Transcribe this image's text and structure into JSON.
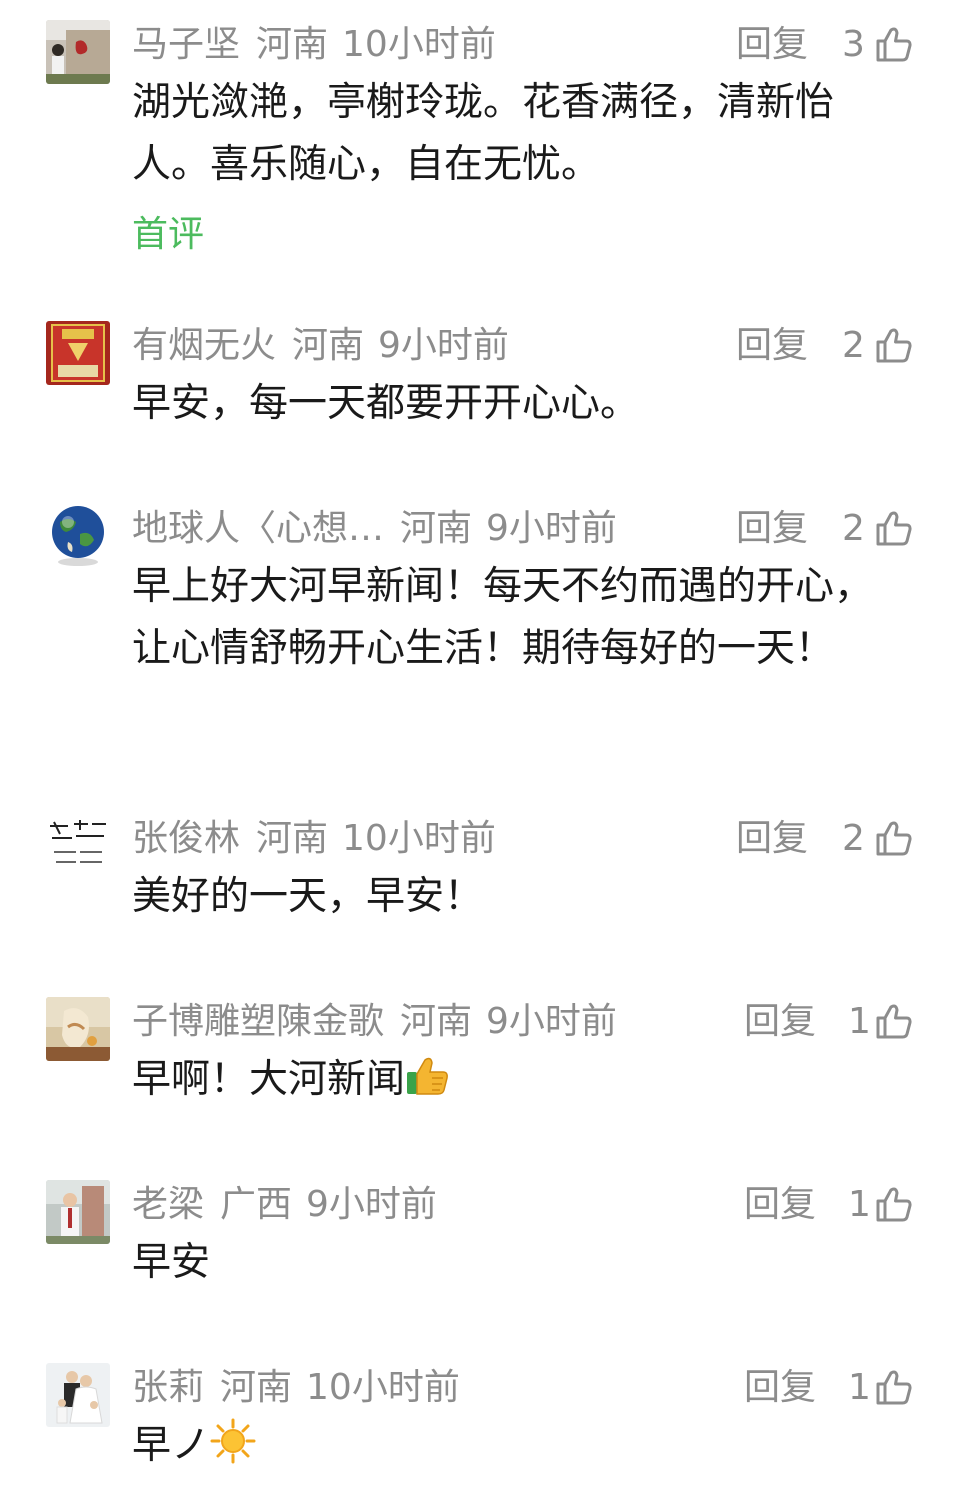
{
  "comments": [
    {
      "name": "马子坚",
      "region": "河南",
      "time": "10小时前",
      "reply": "回复",
      "likes": "3",
      "text": "湖光潋滟，亭榭玲珑。花香满径，清新怡人。喜乐随心，自在无忧。",
      "tag": "首评"
    },
    {
      "name": "有烟无火",
      "region": "河南",
      "time": "9小时前",
      "reply": "回复",
      "likes": "2",
      "text": "早安，每一天都要开开心心。"
    },
    {
      "name": "地球人〈心想…",
      "region": "河南",
      "time": "9小时前",
      "reply": "回复",
      "likes": "2",
      "text": "早上好大河早新闻！每天不约而遇的开心，让心情舒畅开心生活！期待每好的一天！"
    },
    {
      "name": "张俊林",
      "region": "河南",
      "time": "10小时前",
      "reply": "回复",
      "likes": "2",
      "text": "美好的一天，早安！"
    },
    {
      "name": "子博雕塑陳金歌",
      "region": "河南",
      "time": "9小时前",
      "reply": "回复",
      "likes": "1",
      "text": "早啊！大河新闻",
      "emoji": "thumbs-up-emoji"
    },
    {
      "name": "老梁",
      "region": "广西",
      "time": "9小时前",
      "reply": "回复",
      "likes": "1",
      "text": "早安"
    },
    {
      "name": "张莉",
      "region": "河南",
      "time": "10小时前",
      "reply": "回复",
      "likes": "1",
      "text": "早ノ",
      "emoji": "sun-emoji"
    }
  ],
  "colors": {
    "meta": "#8c8c8c",
    "text": "#1a1a1a",
    "first_tag": "#4cbb5e"
  }
}
